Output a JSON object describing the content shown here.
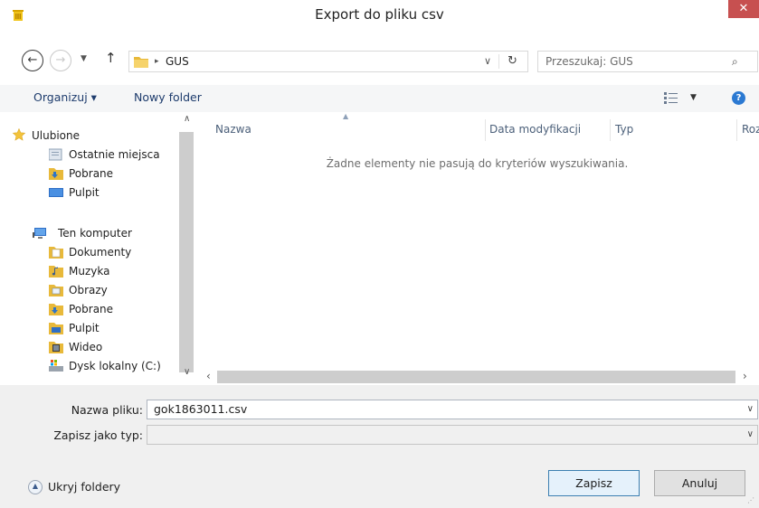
{
  "window": {
    "title": "Export do pliku csv",
    "close_glyph": "✕"
  },
  "nav": {
    "back_glyph": "←",
    "forward_glyph": "→",
    "recent_glyph": "▼",
    "up_glyph": "↑",
    "breadcrumb": [
      "GUS"
    ],
    "address_dropdown_glyph": "∨",
    "refresh_glyph": "↻",
    "search_placeholder": "Przeszukaj: GUS",
    "search_glyph": "⌕"
  },
  "toolbar": {
    "organize_label": "Organizuj ▾",
    "new_folder_label": "Nowy folder",
    "view_dropdown_glyph": "▼",
    "help_glyph": "?"
  },
  "sidebar": {
    "favorites": {
      "label": "Ulubione",
      "items": [
        {
          "label": "Ostatnie miejsca",
          "icon": "recent-places-icon"
        },
        {
          "label": "Pobrane",
          "icon": "downloads-folder-icon"
        },
        {
          "label": "Pulpit",
          "icon": "desktop-icon"
        }
      ]
    },
    "computer": {
      "label": "Ten komputer",
      "items": [
        {
          "label": "Dokumenty",
          "icon": "documents-folder-icon"
        },
        {
          "label": "Muzyka",
          "icon": "music-folder-icon"
        },
        {
          "label": "Obrazy",
          "icon": "pictures-folder-icon"
        },
        {
          "label": "Pobrane",
          "icon": "downloads-folder-icon"
        },
        {
          "label": "Pulpit",
          "icon": "desktop-folder-icon"
        },
        {
          "label": "Wideo",
          "icon": "videos-folder-icon"
        },
        {
          "label": "Dysk lokalny (C:)",
          "icon": "local-disk-icon"
        }
      ]
    }
  },
  "columns": [
    {
      "label": "Nazwa"
    },
    {
      "label": "Data modyfikacji"
    },
    {
      "label": "Typ"
    },
    {
      "label": "Roz"
    }
  ],
  "empty_message": "Żadne elementy nie pasują do kryteriów wyszukiwania.",
  "form": {
    "filename_label": "Nazwa pliku:",
    "filename_value": "gok1863011.csv",
    "filetype_label": "Zapisz jako typ:",
    "filetype_value": ""
  },
  "actions": {
    "hide_folders_label": "Ukryj foldery",
    "save_label": "Zapisz",
    "cancel_label": "Anuluj"
  },
  "colors": {
    "close_button": "#c75050",
    "help_icon": "#2b79d2",
    "folder_yellow": "#e8b93a",
    "primary_border": "#3c7fb1"
  }
}
